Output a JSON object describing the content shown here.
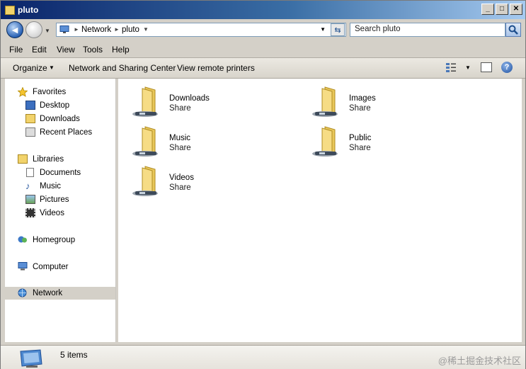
{
  "window": {
    "title": "pluto"
  },
  "address": {
    "crumbs": [
      "Network",
      "pluto"
    ],
    "search_placeholder": "Search pluto"
  },
  "menu": {
    "file": "File",
    "edit": "Edit",
    "view": "View",
    "tools": "Tools",
    "help": "Help"
  },
  "toolbar": {
    "organize": "Organize",
    "network_sharing": "Network and Sharing Center",
    "view_printers": "View remote printers"
  },
  "navpane": {
    "favorites": "Favorites",
    "desktop": "Desktop",
    "downloads": "Downloads",
    "recent_places": "Recent Places",
    "libraries": "Libraries",
    "documents": "Documents",
    "music": "Music",
    "pictures": "Pictures",
    "videos": "Videos",
    "homegroup": "Homegroup",
    "computer": "Computer",
    "network": "Network"
  },
  "items": [
    {
      "name": "Downloads",
      "type": "Share"
    },
    {
      "name": "Images",
      "type": "Share"
    },
    {
      "name": "Music",
      "type": "Share"
    },
    {
      "name": "Public",
      "type": "Share"
    },
    {
      "name": "Videos",
      "type": "Share"
    }
  ],
  "status": {
    "count": "5 items"
  },
  "watermark": "@稀土掘金技术社区",
  "colors": {
    "titlebar": "#0a246a",
    "selection": "#d4d0c8",
    "folder": "#f2d36b"
  }
}
